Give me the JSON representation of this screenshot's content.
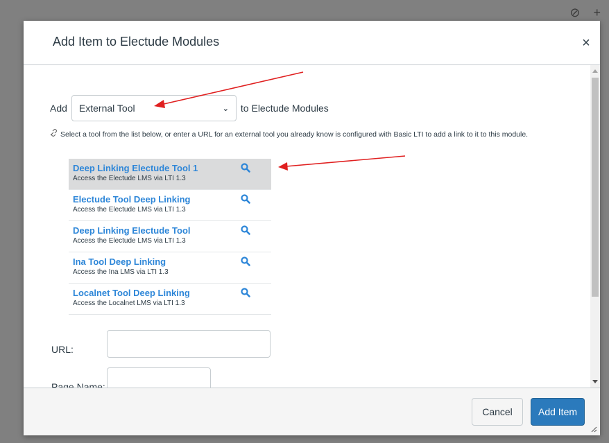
{
  "modal": {
    "title": "Add Item to Electude Modules",
    "close_label": "×"
  },
  "add_row": {
    "prefix": "Add",
    "selected_type": "External Tool",
    "suffix": "to Electude Modules"
  },
  "help_text": "Select a tool from the list below, or enter a URL for an external tool you already know is configured with Basic LTI to add a link to it to this module.",
  "tools": [
    {
      "name": "Deep Linking Electude Tool 1",
      "description": "Access the Electude LMS via LTI 1.3",
      "selected": true
    },
    {
      "name": "Electude Tool Deep Linking",
      "description": "Access the Electude LMS via LTI 1.3",
      "selected": false
    },
    {
      "name": "Deep Linking Electude Tool",
      "description": "Access the Electude LMS via LTI 1.3",
      "selected": false
    },
    {
      "name": "Ina Tool Deep Linking",
      "description": "Access the Ina LMS via LTI 1.3",
      "selected": false
    },
    {
      "name": "Localnet Tool Deep Linking",
      "description": "Access the Localnet LMS via LTI 1.3",
      "selected": false
    }
  ],
  "url_label": "URL:",
  "page_name_label": "Page Name:",
  "footer": {
    "cancel_label": "Cancel",
    "add_label": "Add Item"
  },
  "colors": {
    "link": "#2d86d8",
    "primary_button": "#2b7abc",
    "annotation_arrow": "#e02020"
  }
}
